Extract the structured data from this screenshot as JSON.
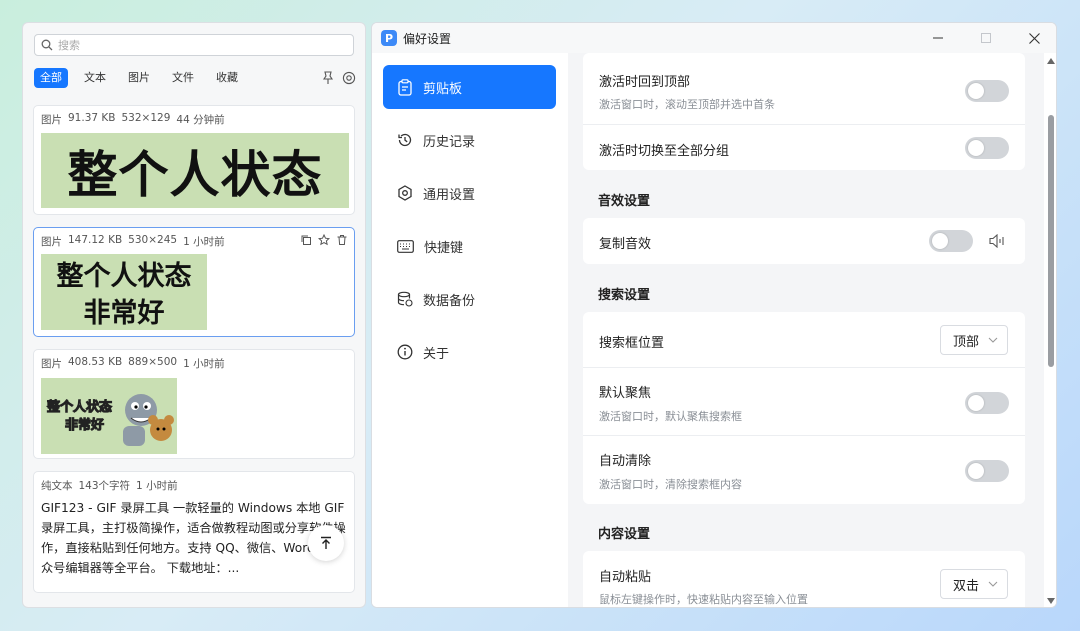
{
  "clipboard": {
    "search_placeholder": "搜索",
    "tabs": [
      "全部",
      "文本",
      "图片",
      "文件",
      "收藏"
    ],
    "items": [
      {
        "type": "图片",
        "size": "91.37 KB",
        "dims": "532×129",
        "time": "44 分钟前",
        "thumb_lines": [
          "整个人状态"
        ]
      },
      {
        "type": "图片",
        "size": "147.12 KB",
        "dims": "530×245",
        "time": "1 小时前",
        "thumb_lines": [
          "整个人状态",
          "非常好"
        ]
      },
      {
        "type": "图片",
        "size": "408.53 KB",
        "dims": "889×500",
        "time": "1 小时前",
        "thumb_lines": [
          "整个人状态",
          "非常好"
        ]
      },
      {
        "type": "纯文本",
        "size": "143个字符",
        "time": "1 小时前",
        "text": "GIF123 -  GIF 录屏工具 一款轻量的 Windows 本地 GIF 录屏工具，主打极简操作，适合做教程动图或分享软件操作，直接粘贴到任何地方。支持 QQ、微信、Word、公众号编辑器等全平台。 下载地址：..."
      }
    ]
  },
  "window": {
    "title": "偏好设置",
    "logo_letter": "P"
  },
  "nav": [
    {
      "label": "剪贴板",
      "icon": "clipboard-icon"
    },
    {
      "label": "历史记录",
      "icon": "history-icon"
    },
    {
      "label": "通用设置",
      "icon": "settings-icon"
    },
    {
      "label": "快捷键",
      "icon": "keyboard-icon"
    },
    {
      "label": "数据备份",
      "icon": "database-icon"
    },
    {
      "label": "关于",
      "icon": "info-icon"
    }
  ],
  "settings": {
    "activate_top": {
      "title": "激活时回到顶部",
      "desc": "激活窗口时，滚动至顶部并选中首条"
    },
    "activate_switch": {
      "title": "激活时切换至全部分组"
    },
    "sound_section": "音效设置",
    "copy_sound": {
      "title": "复制音效"
    },
    "search_section": "搜索设置",
    "search_pos": {
      "title": "搜索框位置",
      "value": "顶部"
    },
    "default_focus": {
      "title": "默认聚焦",
      "desc": "激活窗口时，默认聚焦搜索框"
    },
    "auto_clear": {
      "title": "自动清除",
      "desc": "激活窗口时，清除搜索框内容"
    },
    "content_section": "内容设置",
    "auto_paste": {
      "title": "自动粘贴",
      "desc": "鼠标左键操作时，快速粘贴内容至输入位置",
      "value": "双击"
    }
  },
  "colors": {
    "accent": "#1677ff",
    "thumb_bg": "#c9dfb3"
  }
}
